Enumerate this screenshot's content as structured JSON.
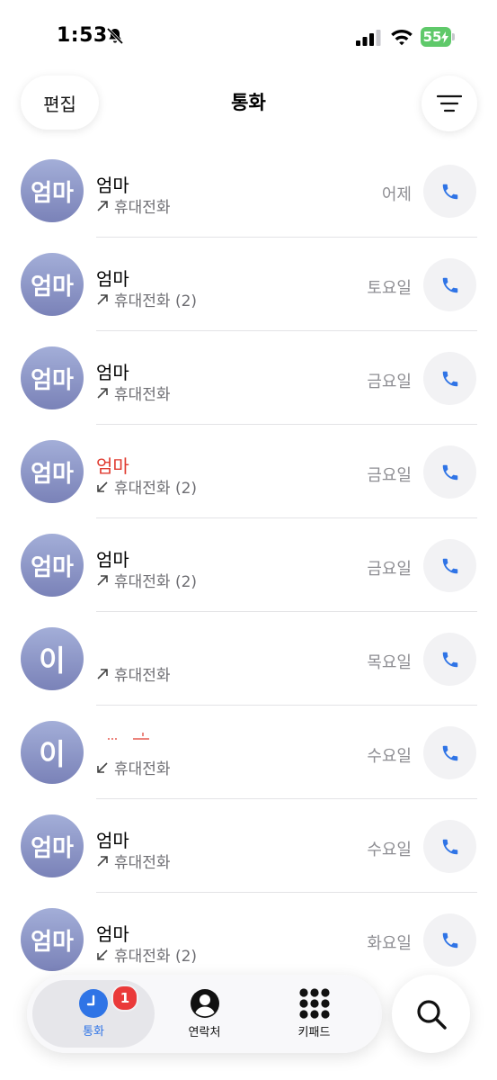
{
  "status_bar": {
    "time": "1:53",
    "battery": "55"
  },
  "header": {
    "edit_label": "편집",
    "title": "통화"
  },
  "calls": [
    {
      "avatar": "엄마",
      "name": "엄마",
      "direction": "outgoing",
      "type": "휴대전화",
      "day": "어제",
      "missed": false
    },
    {
      "avatar": "엄마",
      "name": "엄마",
      "direction": "outgoing",
      "type": "휴대전화 (2)",
      "day": "토요일",
      "missed": false
    },
    {
      "avatar": "엄마",
      "name": "엄마",
      "direction": "outgoing",
      "type": "휴대전화",
      "day": "금요일",
      "missed": false
    },
    {
      "avatar": "엄마",
      "name": "엄마",
      "direction": "incoming",
      "type": "휴대전화 (2)",
      "day": "금요일",
      "missed": true
    },
    {
      "avatar": "엄마",
      "name": "엄마",
      "direction": "outgoing",
      "type": "휴대전화 (2)",
      "day": "금요일",
      "missed": false
    },
    {
      "avatar": "이",
      "name": "",
      "direction": "outgoing",
      "type": "휴대전화",
      "day": "목요일",
      "missed": false
    },
    {
      "avatar": "이",
      "name": "",
      "direction": "incoming",
      "type": "휴대전화",
      "day": "수요일",
      "missed": false
    },
    {
      "avatar": "엄마",
      "name": "엄마",
      "direction": "outgoing",
      "type": "휴대전화",
      "day": "수요일",
      "missed": false
    },
    {
      "avatar": "엄마",
      "name": "엄마",
      "direction": "incoming",
      "type": "휴대전화 (2)",
      "day": "화요일",
      "missed": false
    }
  ],
  "tab_bar": {
    "tabs": [
      {
        "label": "통화",
        "icon": "clock-icon",
        "badge": "1"
      },
      {
        "label": "연락처",
        "icon": "person-circle-icon"
      },
      {
        "label": "키패드",
        "icon": "keypad-icon"
      }
    ]
  },
  "colors": {
    "accent": "#2f74e6",
    "missed": "#e03a2f",
    "badge": "#ea3a3a"
  }
}
